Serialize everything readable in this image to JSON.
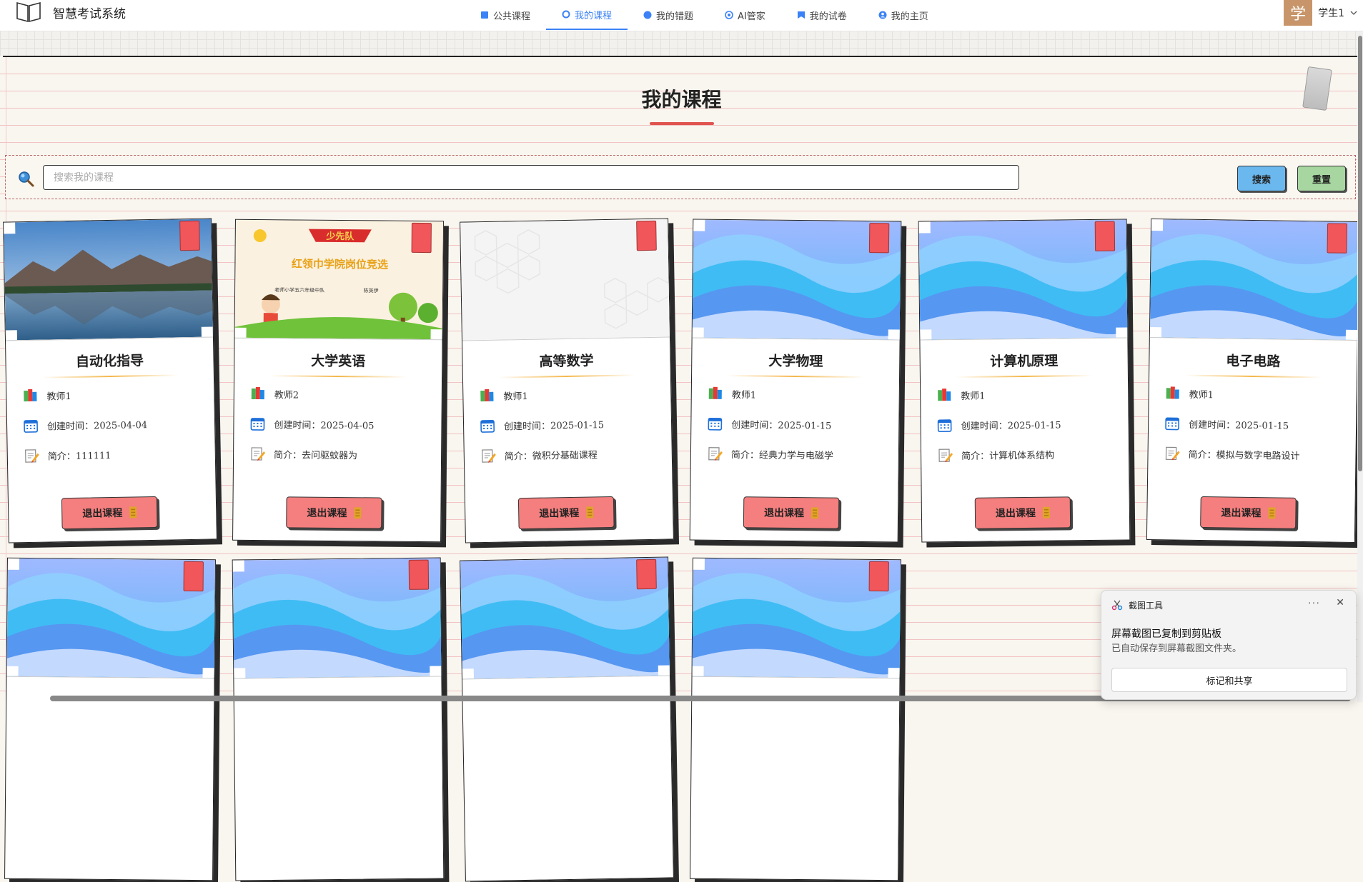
{
  "app": {
    "title": "智慧考试系统"
  },
  "nav": {
    "items": [
      {
        "label": "公共课程",
        "icon": "book-icon"
      },
      {
        "label": "我的课程",
        "icon": "circle-icon",
        "active": true
      },
      {
        "label": "我的错题",
        "icon": "dot-icon"
      },
      {
        "label": "AI管家",
        "icon": "target-icon"
      },
      {
        "label": "我的试卷",
        "icon": "bookmark-icon"
      },
      {
        "label": "我的主页",
        "icon": "user-icon"
      }
    ]
  },
  "user": {
    "avatar_text": "学",
    "name": "学生1"
  },
  "page": {
    "title": "我的课程"
  },
  "search": {
    "placeholder": "搜索我的课程",
    "value": "",
    "search_label": "搜索",
    "reset_label": "重置"
  },
  "courses": [
    {
      "title": "自动化指导",
      "teacher": "教师1",
      "created": "创建时间：2025-04-04",
      "intro": "简介：111111",
      "exit_label": "退出课程",
      "image": "lake-landscape"
    },
    {
      "title": "大学英语",
      "teacher": "教师2",
      "created": "创建时间：2025-04-05",
      "intro": "简介：去问驱蚊器为",
      "exit_label": "退出课程",
      "image": "poster-cartoon"
    },
    {
      "title": "高等数学",
      "teacher": "教师1",
      "created": "创建时间：2025-01-15",
      "intro": "简介：微积分基础课程",
      "exit_label": "退出课程",
      "image": "white-hexagon"
    },
    {
      "title": "大学物理",
      "teacher": "教师1",
      "created": "创建时间：2025-01-15",
      "intro": "简介：经典力学与电磁学",
      "exit_label": "退出课程",
      "image": "blue-waves"
    },
    {
      "title": "计算机原理",
      "teacher": "教师1",
      "created": "创建时间：2025-01-15",
      "intro": "简介：计算机体系结构",
      "exit_label": "退出课程",
      "image": "blue-waves"
    },
    {
      "title": "电子电路",
      "teacher": "教师1",
      "created": "创建时间：2025-01-15",
      "intro": "简介：模拟与数字电路设计",
      "exit_label": "退出课程",
      "image": "blue-waves"
    },
    {
      "image": "blue-waves"
    },
    {
      "image": "blue-waves"
    },
    {
      "image": "blue-waves"
    },
    {
      "image": "blue-waves"
    }
  ],
  "poster": {
    "banner": "少先队",
    "headline": "红领巾学院岗位竞选",
    "sub_left": "老师小学五六年级中队",
    "sub_right": "陈英伊"
  },
  "notification": {
    "app": "截图工具",
    "more": "···",
    "close": "✕",
    "title": "屏幕截图已复制到剪贴板",
    "body": "已自动保存到屏幕截图文件夹。",
    "action": "标记和共享"
  },
  "colors": {
    "accent": "#3b82f6",
    "bookmark": "#f0565a",
    "exit_button": "#f47f7e",
    "search_button": "#6bb8ef",
    "reset_button": "#a7d6a0"
  }
}
